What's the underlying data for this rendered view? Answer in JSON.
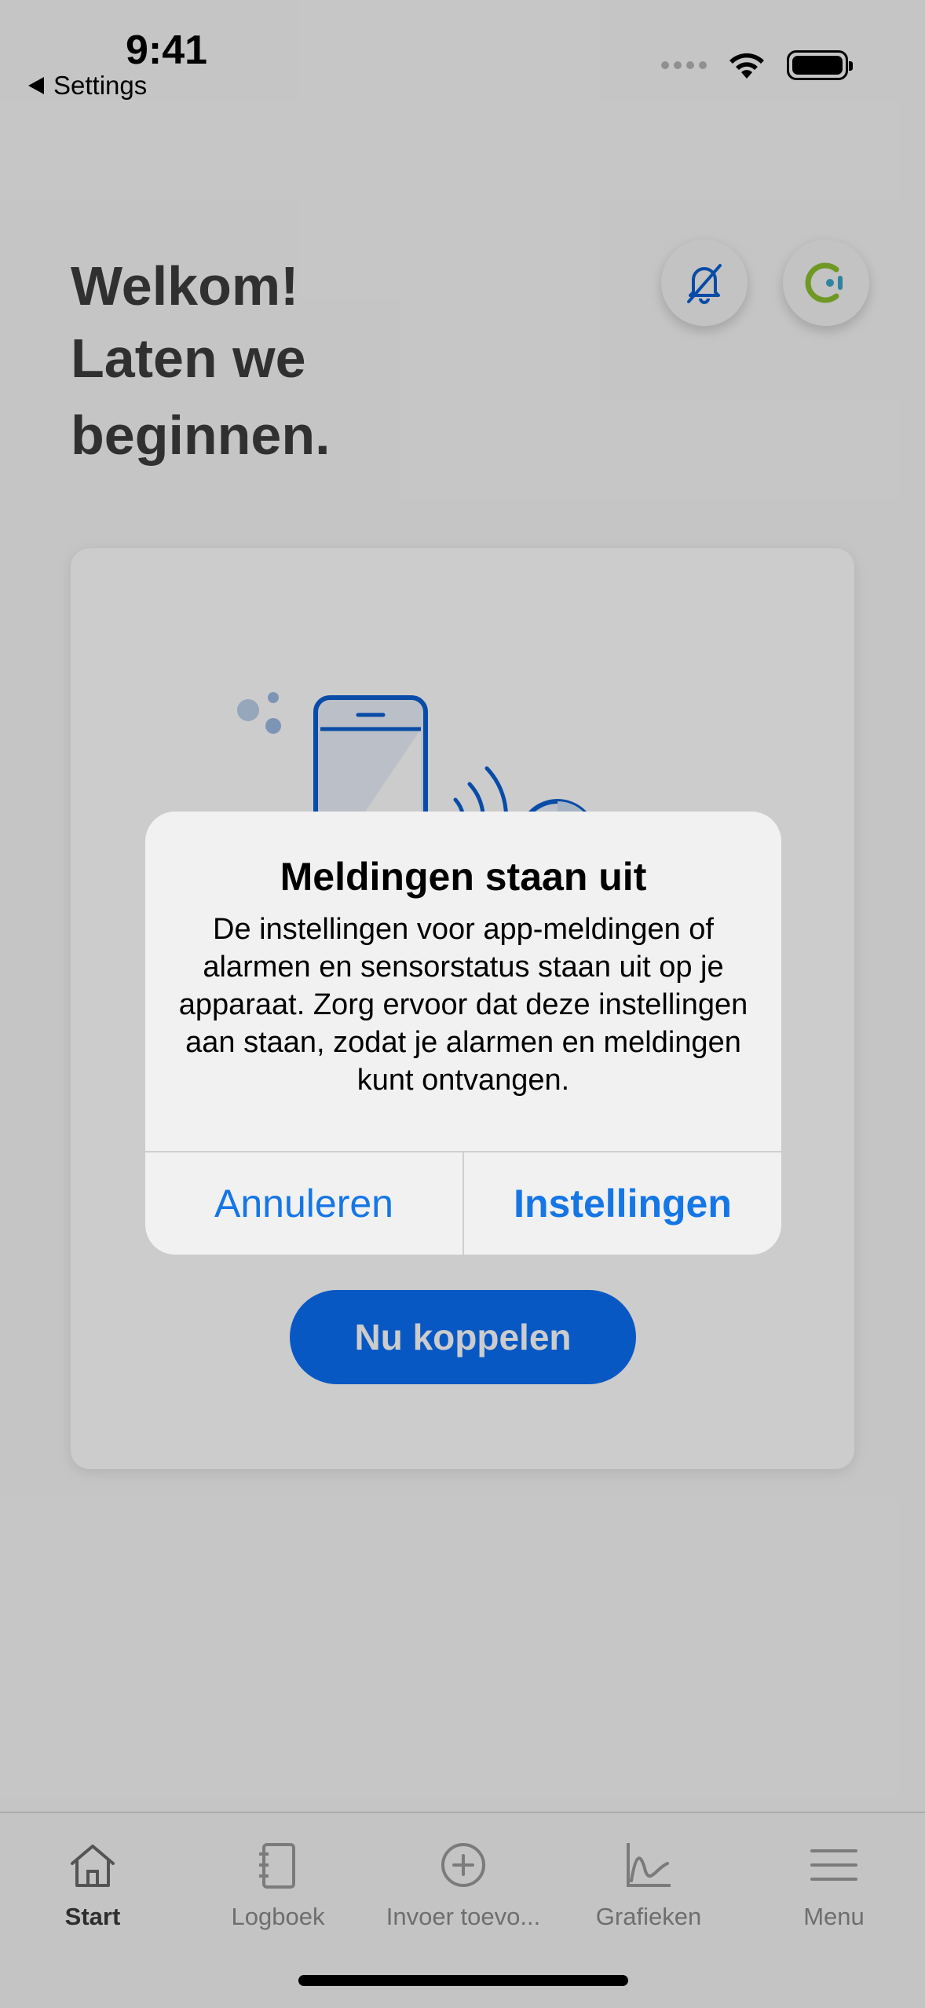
{
  "status_bar": {
    "time": "9:41",
    "back_label": "Settings"
  },
  "header": {
    "welcome_line1": "Welkom!",
    "welcome_line2": "Laten we",
    "welcome_line3": "beginnen."
  },
  "card": {
    "connect_button": "Nu koppelen"
  },
  "alert": {
    "title": "Meldingen staan uit",
    "message": "De instellingen voor app-meldingen of alarmen en sensorstatus staan uit op je apparaat. Zorg ervoor dat deze instellingen aan staan, zodat je alarmen en meldingen kunt ontvangen.",
    "cancel": "Annuleren",
    "settings": "Instellingen"
  },
  "tabs": [
    {
      "label": "Start",
      "icon": "home-icon",
      "active": true
    },
    {
      "label": "Logboek",
      "icon": "logbook-icon",
      "active": false
    },
    {
      "label": "Invoer toevo...",
      "icon": "add-circle-icon",
      "active": false
    },
    {
      "label": "Grafieken",
      "icon": "chart-icon",
      "active": false
    },
    {
      "label": "Menu",
      "icon": "menu-icon",
      "active": false
    }
  ],
  "colors": {
    "accent": "#0a6ff5",
    "alert_link": "#1576e6",
    "illustration_blue": "#0a5fd1",
    "brand_green": "#8cbf2f",
    "brand_teal": "#3aa6c9"
  }
}
